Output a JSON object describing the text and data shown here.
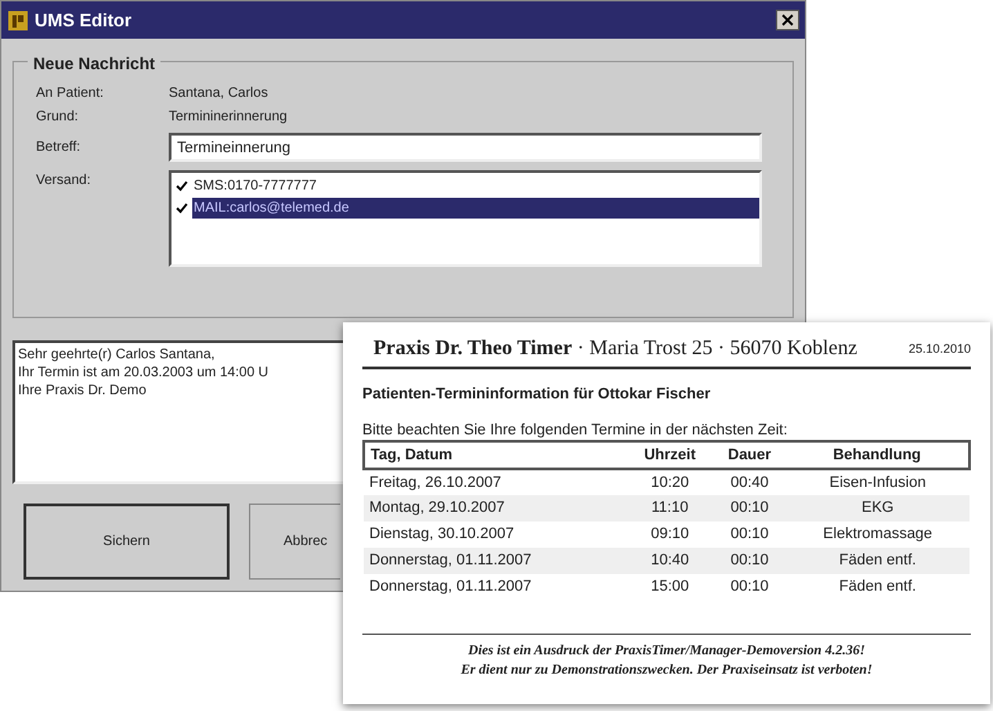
{
  "window": {
    "title": "UMS Editor"
  },
  "group": {
    "title": "Neue Nachricht"
  },
  "info": [
    {
      "label": "An Patient:",
      "value": "Santana, Carlos"
    },
    {
      "label": "Grund:",
      "value": "Termininerinnerung"
    }
  ],
  "subject": {
    "label": "Betreff:",
    "value": "Termineinnerung"
  },
  "dispatch": {
    "label": "Versand:",
    "items": [
      {
        "text": "SMS:0170-7777777",
        "checked": true,
        "selected": false
      },
      {
        "text": "MAIL:carlos@telemed.de",
        "checked": true,
        "selected": true
      }
    ]
  },
  "message": [
    "Sehr geehrte(r) Carlos Santana,",
    "Ihr Termin ist am 20.03.2003 um 14:00 U",
    "Ihre Praxis Dr. Demo"
  ],
  "buttons": [
    "Sichern",
    "Abbrec"
  ],
  "printout": {
    "header": "**Praxis Dr. Theo Timer** · Maria Trost 25 · 56070 Koblenz",
    "date": "25.10.2010",
    "title": "Patienten-Termininformation für Ottokar Fischer",
    "intro": "Bitte beachten Sie Ihre folgenden Termine in der nächsten Zeit:",
    "columns": [
      "Tag, Datum",
      "Uhrzeit",
      "Dauer",
      "Behandlung"
    ],
    "rows": [
      [
        "Freitag, 26.10.2007",
        "10:20",
        "00:40",
        "Eisen-Infusion"
      ],
      [
        "Montag, 29.10.2007",
        "11:10",
        "00:10",
        "EKG"
      ],
      [
        "Dienstag, 30.10.2007",
        "09:10",
        "00:10",
        "Elektromassage"
      ],
      [
        "Donnerstag, 01.11.2007",
        "10:40",
        "00:10",
        "Fäden entf."
      ],
      [
        "Donnerstag, 01.11.2007",
        "15:00",
        "00:10",
        "Fäden entf."
      ]
    ],
    "footer": [
      "Dies ist ein Ausdruck der PraxisTimer/Manager-Demoversion 4.2.36!",
      "Er dient nur zu Demonstrationszwecken. Der Praxiseinsatz ist verboten!"
    ]
  }
}
